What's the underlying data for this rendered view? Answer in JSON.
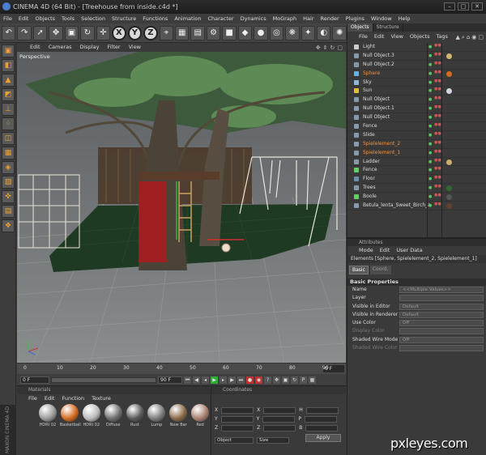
{
  "window": {
    "title": "CINEMA 4D (64 Bit) - [Treehouse from inside.c4d *]",
    "controls": [
      "–",
      "□",
      "✕"
    ]
  },
  "menubar": [
    "File",
    "Edit",
    "Objects",
    "Tools",
    "Selection",
    "Structure",
    "Functions",
    "Animation",
    "Character",
    "Dynamics",
    "MoGraph",
    "Hair",
    "Render",
    "Plugins",
    "Window",
    "Help"
  ],
  "toolbar": {
    "tools": [
      {
        "name": "undo-icon",
        "glyph": "↶"
      },
      {
        "name": "redo-icon",
        "glyph": "↷"
      },
      {
        "name": "live-selection-icon",
        "glyph": "➚"
      },
      {
        "name": "move-icon",
        "glyph": "✥"
      },
      {
        "name": "scale-icon",
        "glyph": "▣"
      },
      {
        "name": "rotate-icon",
        "glyph": "↻"
      },
      {
        "name": "recent-tools-icon",
        "glyph": "✛"
      }
    ],
    "axes": [
      "X",
      "Y",
      "Z"
    ],
    "more": [
      {
        "name": "world-coordinates-icon",
        "glyph": "⌖"
      },
      {
        "name": "render-view-icon",
        "glyph": "▦"
      },
      {
        "name": "render-picture-viewer-icon",
        "glyph": "▤"
      },
      {
        "name": "edit-render-settings-icon",
        "glyph": "⚙"
      },
      {
        "name": "cube-icon",
        "glyph": "■"
      },
      {
        "name": "spline-icon",
        "glyph": "◆"
      },
      {
        "name": "nurbs-icon",
        "glyph": "●"
      },
      {
        "name": "array-icon",
        "glyph": "◎"
      },
      {
        "name": "deformer-icon",
        "glyph": "❋"
      },
      {
        "name": "scene-icon",
        "glyph": "✦"
      },
      {
        "name": "camera-icon",
        "glyph": "◐"
      },
      {
        "name": "light-icon",
        "glyph": "✺"
      }
    ]
  },
  "viewport": {
    "menu": [
      "Edit",
      "Cameras",
      "Display",
      "Filter",
      "View"
    ],
    "label": "Perspective"
  },
  "timeline": {
    "ticks": [
      "0",
      "10",
      "20",
      "30",
      "40",
      "50",
      "60",
      "70",
      "80",
      "90"
    ],
    "current_frame": "0 F",
    "start_field": "0 F",
    "end_field": "90 F"
  },
  "materials": {
    "title": "Materials",
    "menu": [
      "File",
      "Edit",
      "Function",
      "Texture"
    ],
    "items": [
      {
        "label": "HDRI 02",
        "color": "#9a9a9a"
      },
      {
        "label": "Basketball",
        "color": "#d46a1e"
      },
      {
        "label": "HDRI 02",
        "color": "#bcbcbc"
      },
      {
        "label": "Diffuse",
        "color": "#6e6e6e"
      },
      {
        "label": "Rust",
        "color": "#5a5a5a"
      },
      {
        "label": "Lump",
        "color": "#7d7d7d"
      },
      {
        "label": "New Bar",
        "color": "#8a6a4a"
      },
      {
        "label": "Red",
        "color": "#aa8070"
      }
    ],
    "brand": "MAXON CINEMA 4D"
  },
  "coordinates": {
    "title": "Coordinates",
    "rows": [
      {
        "a": "X",
        "b": "X",
        "c": "H"
      },
      {
        "a": "Y",
        "b": "Y",
        "c": "P"
      },
      {
        "a": "Z",
        "b": "Z",
        "c": "B"
      }
    ],
    "mode1": "Object",
    "mode2": "Size",
    "apply": "Apply"
  },
  "objects_manager": {
    "tabs": [
      "Objects",
      "Structure"
    ],
    "menu": [
      "File",
      "Edit",
      "View",
      "Objects",
      "Tags"
    ],
    "items": [
      {
        "name": "Light",
        "selected": false,
        "icon": "#cccccc",
        "tag": ""
      },
      {
        "name": "Null Object.3",
        "selected": false,
        "icon": "#8899aa",
        "tag": "#d0b870"
      },
      {
        "name": "Null Object.2",
        "selected": false,
        "icon": "#8899aa",
        "tag": ""
      },
      {
        "name": "Sphere",
        "selected": true,
        "icon": "#6ab0e0",
        "tag": "#d46a1e"
      },
      {
        "name": "Sky",
        "selected": false,
        "icon": "#8fb8d8",
        "tag": ""
      },
      {
        "name": "Sun",
        "selected": false,
        "icon": "#e0c040",
        "tag": "#cfd8e0"
      },
      {
        "name": "Null Object",
        "selected": false,
        "icon": "#8899aa",
        "tag": ""
      },
      {
        "name": "Null Object.1",
        "selected": false,
        "icon": "#8899aa",
        "tag": ""
      },
      {
        "name": "Null Object",
        "selected": false,
        "icon": "#8899aa",
        "tag": ""
      },
      {
        "name": "Fence",
        "selected": false,
        "icon": "#8899aa",
        "tag": ""
      },
      {
        "name": "Slide",
        "selected": false,
        "icon": "#8899aa",
        "tag": ""
      },
      {
        "name": "Spielelement_2",
        "selected": true,
        "icon": "#8899aa",
        "tag": ""
      },
      {
        "name": "Spielelement_1",
        "selected": true,
        "icon": "#8899aa",
        "tag": ""
      },
      {
        "name": "Ladder",
        "selected": false,
        "icon": "#8899aa",
        "tag": "#c8b070"
      },
      {
        "name": "Fence",
        "selected": false,
        "icon": "#66cc66",
        "tag": ""
      },
      {
        "name": "Floor",
        "selected": false,
        "icon": "#6a90b0",
        "tag": ""
      },
      {
        "name": "Trees",
        "selected": false,
        "icon": "#8899aa",
        "tag": "#336633"
      },
      {
        "name": "Boole",
        "selected": false,
        "icon": "#66cc66",
        "tag": "#555555"
      },
      {
        "name": "Betula_lenta_Sweet_Birch_a",
        "selected": false,
        "icon": "#8899aa",
        "tag": "#604030"
      }
    ]
  },
  "attributes": {
    "title": "Attributes",
    "menu": [
      "Mode",
      "Edit",
      "User Data"
    ],
    "elements": "Elements [Sphere, Spielelement_2, Spielelement_1]",
    "tabs": [
      "Basic",
      "Coord."
    ],
    "section": "Basic Properties",
    "rows": [
      {
        "label": "Name",
        "value": "<<Multiple Values>>",
        "dim": false
      },
      {
        "label": "Layer",
        "value": "",
        "dim": false
      },
      {
        "label": "Visible in Editor",
        "value": "Default",
        "dim": false
      },
      {
        "label": "Visible in Renderer",
        "value": "Default",
        "dim": false
      },
      {
        "label": "Use Color",
        "value": "Off",
        "dim": false
      },
      {
        "label": "Display Color",
        "value": "",
        "dim": true
      },
      {
        "label": "Shaded Wire Mode",
        "value": "Off",
        "dim": false
      },
      {
        "label": "Shaded Wire Color",
        "value": "",
        "dim": true
      }
    ]
  },
  "watermark": "pxleyes.com"
}
